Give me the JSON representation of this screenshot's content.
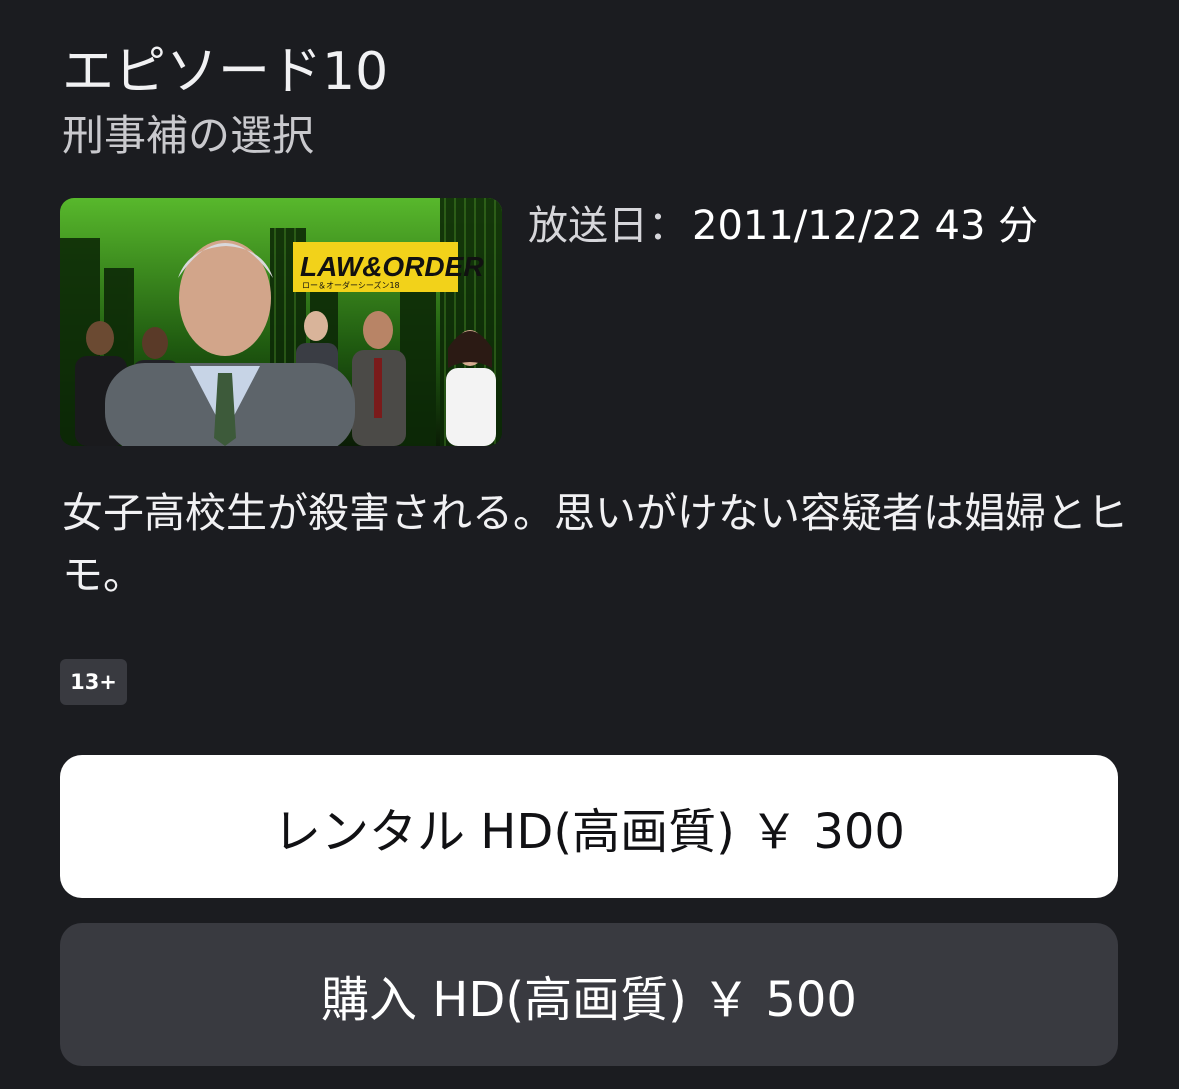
{
  "episode": {
    "title": "エピソード10",
    "subtitle": "刑事補の選択"
  },
  "thumbnail": {
    "logo_main": "LAW&ORDER",
    "logo_sub": "ロー＆オーダーシーズン18"
  },
  "meta": {
    "air_date_label": "放送日：",
    "air_date": "2011/12/22",
    "duration": "43 分"
  },
  "synopsis": "女子高校生が殺害される。思いがけない容疑者は娼婦とヒモ。",
  "rating": "13+",
  "actions": {
    "rent_label": "レンタル HD(高画質) ￥ 300",
    "buy_label": "購入 HD(高画質) ￥ 500"
  },
  "colors": {
    "background": "#1b1c20",
    "primary_button": "#ffffff",
    "secondary_button": "#393a40",
    "logo_yellow": "#f2d21a"
  }
}
